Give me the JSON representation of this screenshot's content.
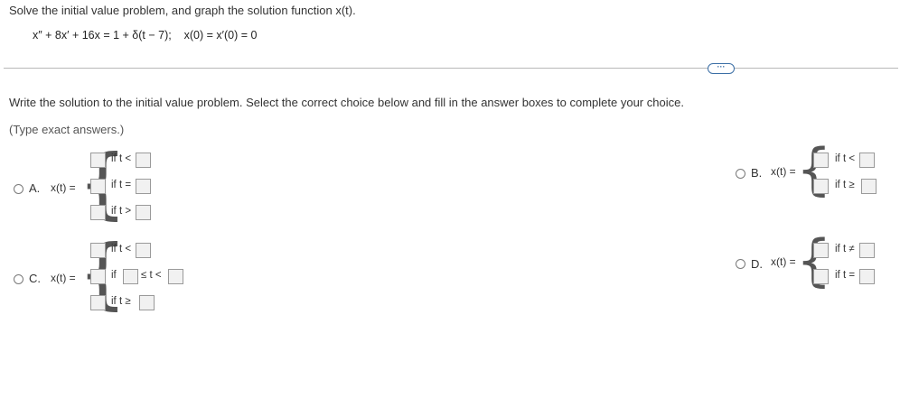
{
  "question": {
    "prompt": "Solve the initial value problem, and graph the solution function x(t).",
    "equation": "x″ + 8x′ + 16x = 1 + δ(t − 7);    x(0) = x′(0) = 0"
  },
  "more_button": "···",
  "instructions": "Write the solution to the initial value problem. Select the correct choice below and fill in the answer boxes to complete your choice.",
  "hint": "(Type exact answers.)",
  "choices": {
    "a": {
      "letter": "A.",
      "lhs": "x(t) =",
      "rows": [
        "if t <",
        "if t =",
        "if t >"
      ]
    },
    "b": {
      "letter": "B.",
      "lhs": "x(t) =",
      "rows": [
        "if t <",
        "if t ≥"
      ]
    },
    "c": {
      "letter": "C.",
      "lhs": "x(t) =",
      "rows": [
        "if t <",
        "if",
        "≤ t <",
        "if t ≥"
      ]
    },
    "d": {
      "letter": "D.",
      "lhs": "x(t) =",
      "rows": [
        "if t ≠",
        "if t ="
      ]
    }
  }
}
